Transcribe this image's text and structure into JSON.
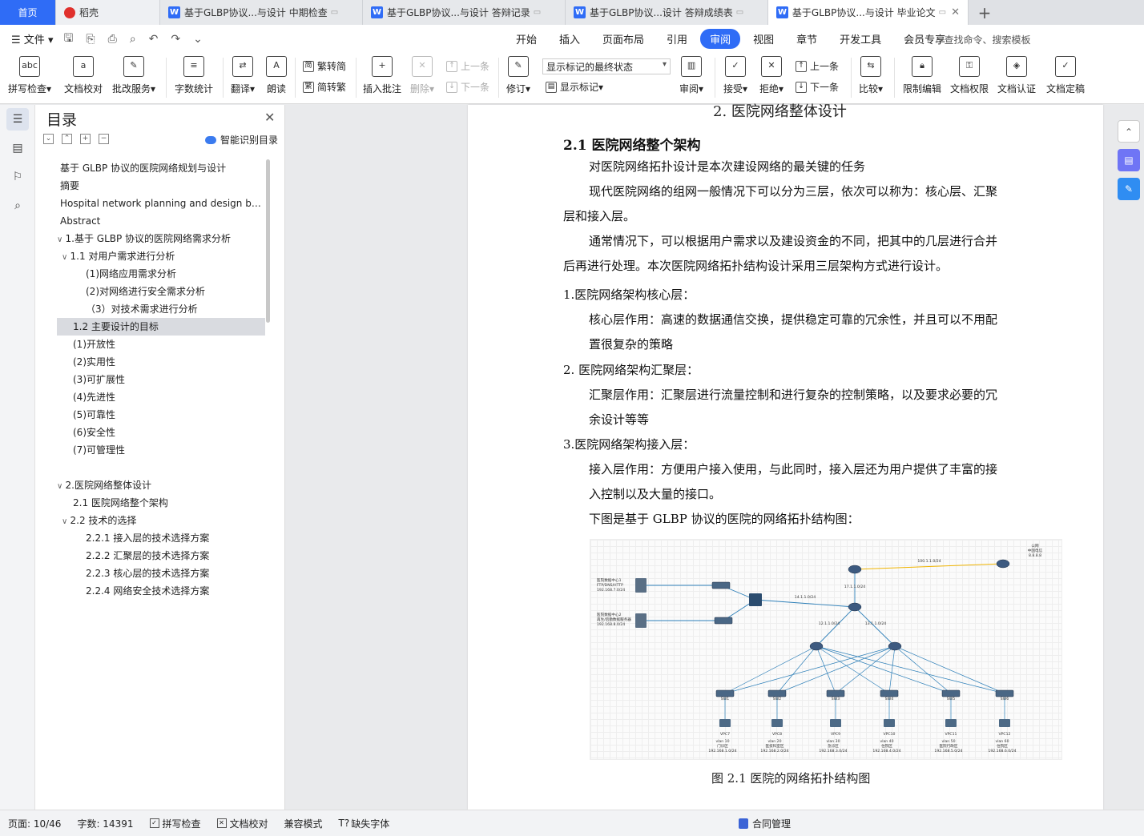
{
  "tabs": {
    "home": "首页",
    "daoke": "稻壳",
    "docs": [
      {
        "title": "基于GLBP协议...与设计 中期检查"
      },
      {
        "title": "基于GLBP协议...与设计 答辩记录"
      },
      {
        "title": "基于GLBP协议...设计 答辩成绩表"
      },
      {
        "title": "基于GLBP协议...与设计 毕业论文"
      }
    ],
    "plus": "+"
  },
  "menu": {
    "file": "文件",
    "tabs": [
      "开始",
      "插入",
      "页面布局",
      "引用",
      "审阅",
      "视图",
      "章节",
      "开发工具",
      "会员专享"
    ],
    "active_tab": "审阅",
    "search": "查找命令、搜索模板"
  },
  "ribbon": {
    "spellcheck": "拼写检查",
    "proofread": "文档校对",
    "review_service": "批改服务",
    "word_count": "字数统计",
    "translate": "翻译",
    "read_aloud": "朗读",
    "trad_to_simp": "繁转简",
    "simp_to_trad": "简转繁",
    "insert_comment": "插入批注",
    "delete": "删除",
    "prev": "上一条",
    "next": "下一条",
    "revise": "修订",
    "show_mode": "显示标记的最终状态",
    "show_marks": "显示标记",
    "review": "审阅",
    "accept": "接受",
    "reject": "拒绝",
    "prev2": "上一条",
    "next2": "下一条",
    "compare": "比较",
    "restrict": "限制编辑",
    "permission": "文档权限",
    "certify": "文档认证",
    "finalize": "文档定稿"
  },
  "toc": {
    "title": "目录",
    "smart": "智能识别目录",
    "items": [
      {
        "text": "基于 GLBP 协议的医院网络规划与设计",
        "indent": 0
      },
      {
        "text": "摘要",
        "indent": 0
      },
      {
        "text": "Hospital network planning and design ba ...",
        "indent": 0
      },
      {
        "text": "Abstract",
        "indent": 0
      },
      {
        "text": "1.基于 GLBP 协议的医院网络需求分析",
        "indent": 0,
        "toggle": "∨"
      },
      {
        "text": "1.1 对用户需求进行分析",
        "indent": 1,
        "toggle": "∨"
      },
      {
        "text": "(1)网络应用需求分析",
        "indent": 2
      },
      {
        "text": "(2)对网络进行安全需求分析",
        "indent": 2
      },
      {
        "text": "（3）对技术需求进行分析",
        "indent": 2
      },
      {
        "text": "1.2 主要设计的目标",
        "indent": 1,
        "selected": true
      },
      {
        "text": "(1)开放性",
        "indent": 1
      },
      {
        "text": "(2)实用性",
        "indent": 1
      },
      {
        "text": "(3)可扩展性",
        "indent": 1
      },
      {
        "text": "(4)先进性",
        "indent": 1
      },
      {
        "text": "(5)可靠性",
        "indent": 1
      },
      {
        "text": "(6)安全性",
        "indent": 1
      },
      {
        "text": "(7)可管理性",
        "indent": 1
      },
      {
        "text": "",
        "indent": 0,
        "gap": true
      },
      {
        "text": "2.医院网络整体设计",
        "indent": 0,
        "toggle": "∨"
      },
      {
        "text": "2.1 医院网络整个架构",
        "indent": 1
      },
      {
        "text": "2.2 技术的选择",
        "indent": 1,
        "toggle": "∨"
      },
      {
        "text": "2.2.1 接入层的技术选择方案",
        "indent": 2
      },
      {
        "text": "2.2.2 汇聚层的技术选择方案",
        "indent": 2
      },
      {
        "text": "2.2.3 核心层的技术选择方案",
        "indent": 2
      },
      {
        "text": "2.2.4 网络安全技术选择方案",
        "indent": 2
      }
    ]
  },
  "doc": {
    "heading_cut": "2. 医院网络整体设计",
    "h21": "2.1 医院网络整个架构",
    "p1": "对医院网络拓扑设计是本次建设网络的最关键的任务",
    "p2": "现代医院网络的组网一般情况下可以分为三层，依次可以称为：核心层、汇聚层和接入层。",
    "p3": "通常情况下，可以根据用户需求以及建设资金的不同，把其中的几层进行合并后再进行处理。本次医院网络拓扑结构设计采用三层架构方式进行设计。",
    "l1": "1.医院网络架构核心层：",
    "l1d": "核心层作用：高速的数据通信交换，提供稳定可靠的冗余性，并且可以不用配置很复杂的策略",
    "l2": "2. 医院网络架构汇聚层：",
    "l2d": "汇聚层作用：汇聚层进行流量控制和进行复杂的控制策略，以及要求必要的冗余设计等等",
    "l3": "3.医院网络架构接入层：",
    "l3d": "接入层作用：方便用户接入使用，与此同时，接入层还为用户提供了丰富的接入控制以及大量的接口。",
    "p4": "下图是基于 GLBP 协议的医院的网络拓扑结构图：",
    "caption": "图 2.1 医院的网络拓扑结构图"
  },
  "figure": {
    "isp_label": "公网\n中国电信\n8.8.8.8",
    "isp_link": "100.1.1.0/24",
    "core_link": "17.1.1.0/24",
    "sw_link": "14.1.1.0/24",
    "r1_link": "12.1.1.0/24",
    "r2_link": "13.1.1.0/24",
    "srv1": "医院数据中心1\nFTP/DNS/HTTP\n192.168.7.0/24",
    "srv2": "医院数据中心2\n再生/后勤数据服务器\n192.168.8.0/24",
    "vlans": [
      {
        "pc": "VPC7",
        "sw": "SW1",
        "vlan": "vlan 10\n门诊区\n192.168.1.0/24"
      },
      {
        "pc": "VPC8",
        "sw": "SW2",
        "vlan": "vlan 20\n医技科室区\n192.168.2.0/24"
      },
      {
        "pc": "VPC9",
        "sw": "SW3",
        "vlan": "vlan 30\n急诊区\n192.168.3.0/24"
      },
      {
        "pc": "VPC10",
        "sw": "SW4",
        "vlan": "vlan 40\n住院区\n192.168.4.0/24"
      },
      {
        "pc": "VPC11",
        "sw": "SW5",
        "vlan": "vlan 50\n医院行政区\n192.168.5.0/24"
      },
      {
        "pc": "VPC12",
        "sw": "SW6",
        "vlan": "vlan 60\n住院区\n192.168.6.0/24"
      }
    ]
  },
  "status": {
    "page": "页面: 10/46",
    "words": "字数: 14391",
    "spell": "拼写检查",
    "proof": "文档校对",
    "compat": "兼容模式",
    "missing_font": "缺失字体",
    "contract": "合同管理"
  },
  "colors": {
    "accent": "#2f6cf6",
    "selected_row": "#d9dbe0",
    "toolbar_bg": "#ffffff"
  }
}
